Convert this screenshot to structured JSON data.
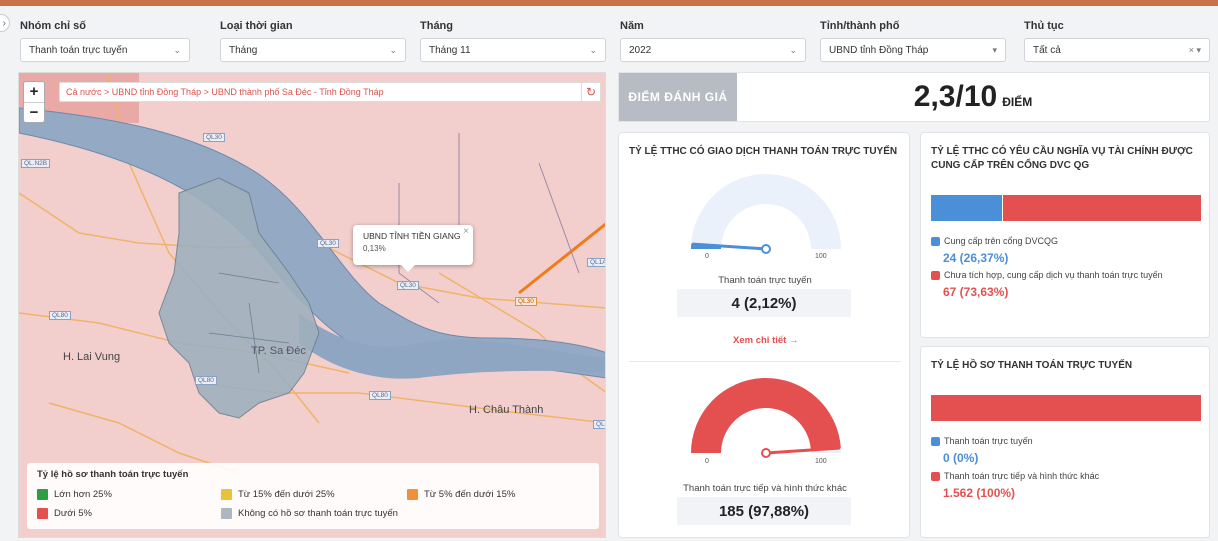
{
  "filters": [
    {
      "label": "Nhóm chỉ số",
      "value": "Thanh toán trực tuyến"
    },
    {
      "label": "Loại thời gian",
      "value": "Tháng"
    },
    {
      "label": "Tháng",
      "value": "Tháng 11"
    },
    {
      "label": "Năm",
      "value": "2022"
    },
    {
      "label": "Tỉnh/thành phố",
      "value": "UBND tỉnh Đồng Tháp"
    },
    {
      "label": "Thủ tục",
      "value": "Tất cả"
    }
  ],
  "map": {
    "breadcrumb": "Cả nước > UBND tỉnh Đồng Tháp > UBND thành phố Sa Đéc - Tỉnh Đồng Tháp",
    "zoom_in": "+",
    "zoom_out": "−",
    "popup": {
      "title": "UBND TỈNH TIỀN GIANG",
      "value": "0,13%",
      "close": "×"
    },
    "places": {
      "lai_vung": "H. Lai Vung",
      "sa_dec": "TP. Sa Đéc",
      "chau_thanh": "H. Châu Thành"
    },
    "roads": {
      "ql30_a": "QL30",
      "ql30_b": "QL30",
      "ql30_c": "QL30",
      "ql30_d": "QL30",
      "ql80_a": "QL80",
      "ql80_b": "QL80",
      "ql80_c": "QL80",
      "ql54": "QL54",
      "ql1a": "QL1A",
      "ql_left": "QL.N2B"
    },
    "legend": {
      "title": "Tỷ lệ hồ sơ thanh toán trực tuyến",
      "items": [
        {
          "label": "Lớn hơn 25%",
          "color": "#2e9e44"
        },
        {
          "label": "Từ 15% đến dưới 25%",
          "color": "#e8c33a"
        },
        {
          "label": "Từ 5% đến dưới 15%",
          "color": "#f0903a"
        },
        {
          "label": "Dưới 5%",
          "color": "#e4504f"
        },
        {
          "label": "Không có hồ sơ thanh toán trực tuyến",
          "color": "#aeb6bf"
        }
      ]
    }
  },
  "score": {
    "label": "ĐIỂM ĐÁNH GIÁ",
    "value": "2,3/10",
    "unit": "ĐIỂM"
  },
  "online_card": {
    "title": "TỶ LỆ TTHC CÓ GIAO DỊCH THANH TOÁN TRỰC TUYẾN",
    "gauge1": {
      "min": "0",
      "max": "100",
      "label": "Thanh toán trực tuyến",
      "value_text": "4 (2,12%)",
      "percent": 2.12,
      "color": "#4a8fd8"
    },
    "link": "Xem chi tiết →",
    "gauge2": {
      "min": "0",
      "max": "100",
      "label": "Thanh toán trực tiếp và hình thức khác",
      "value_text": "185 (97,88%)",
      "percent": 97.88,
      "color": "#e4504f"
    }
  },
  "finance_card": {
    "title": "TỶ LỆ TTHC CÓ YÊU CẦU NGHĨA VỤ TÀI CHÍNH ĐƯỢC CUNG CẤP TRÊN CỔNG DVC QG",
    "items": [
      {
        "label": "Cung cấp trên cổng DVCQG",
        "value": "24 (26,37%)",
        "percent": 26.37,
        "color": "#4a8fd8"
      },
      {
        "label": "Chưa tích hợp, cung cấp dịch vụ thanh toán trực tuyến",
        "value": "67 (73,63%)",
        "percent": 73.63,
        "color": "#e4504f"
      }
    ]
  },
  "dossier_card": {
    "title": "TỶ LỆ HỒ SƠ THANH TOÁN TRỰC TUYẾN",
    "items": [
      {
        "label": "Thanh toán trực tuyến",
        "value": "0 (0%)",
        "percent": 0,
        "color": "#4a8fd8"
      },
      {
        "label": "Thanh toán trực tiếp và hình thức khác",
        "value": "1.562 (100%)",
        "percent": 100,
        "color": "#e4504f"
      }
    ]
  }
}
